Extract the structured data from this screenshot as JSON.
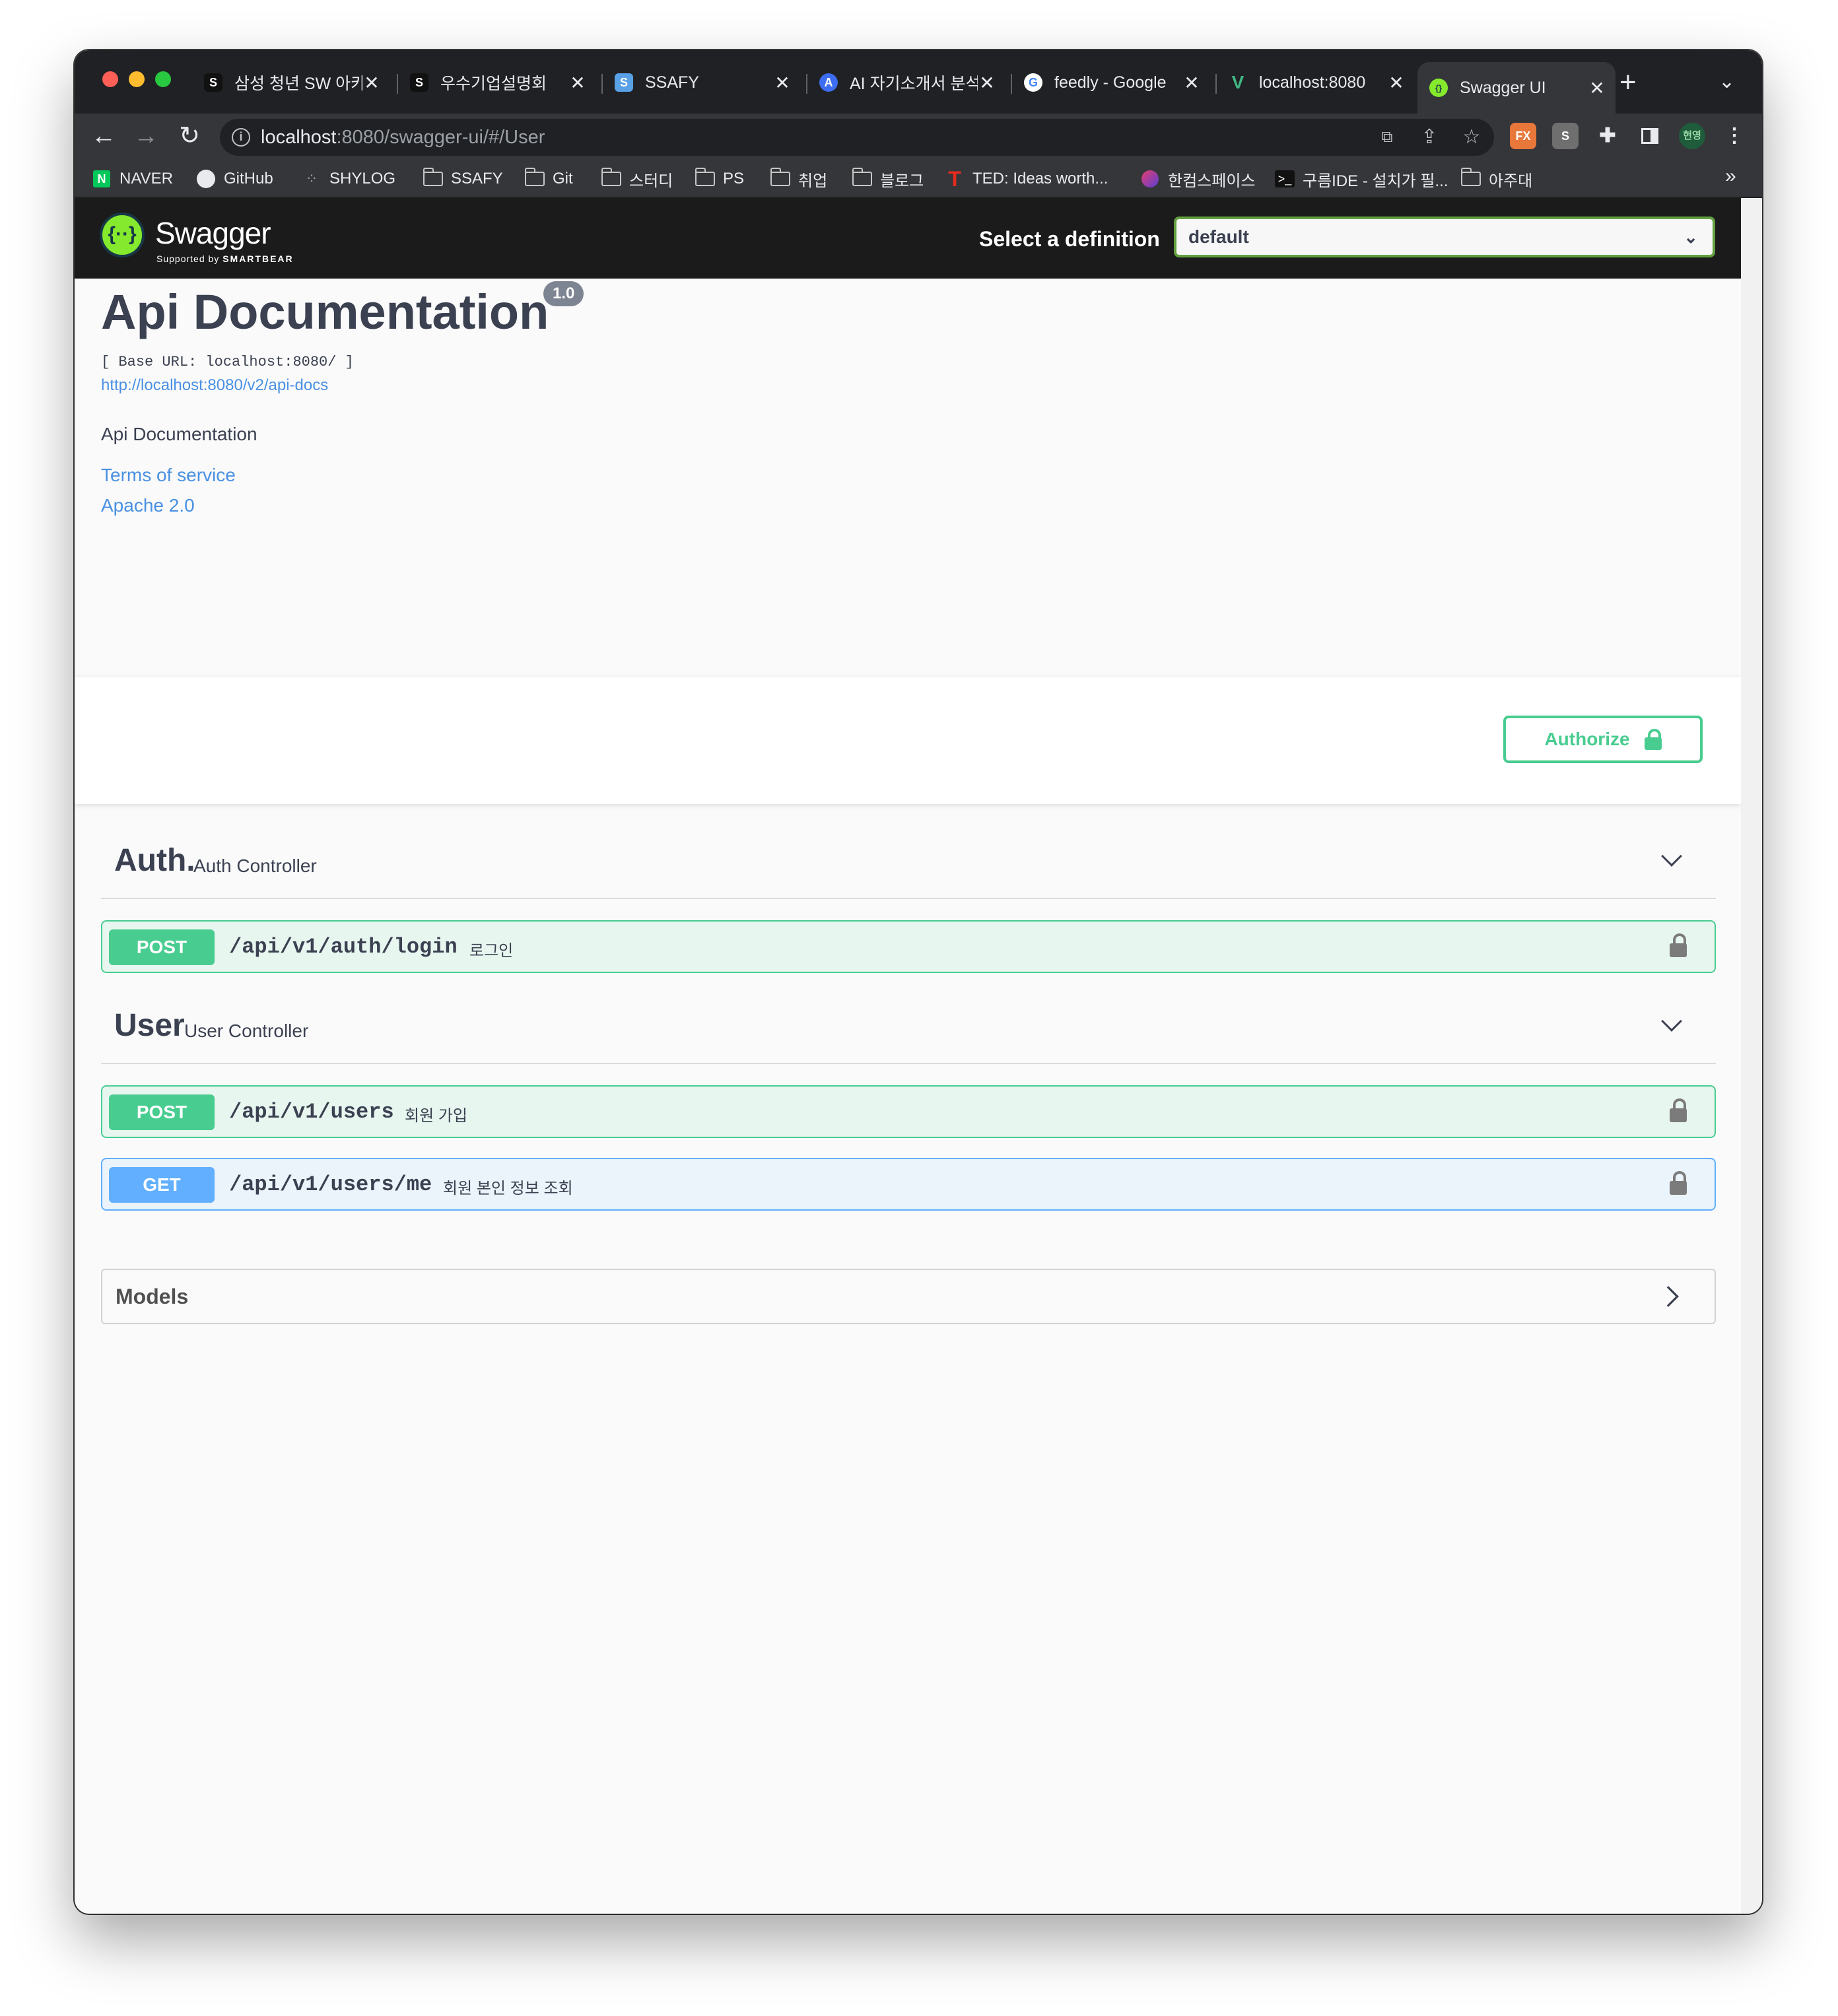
{
  "browser": {
    "tabs": [
      {
        "title": "삼성 청년 SW 아카",
        "favicon_label": "S",
        "favicon_color": "#111111"
      },
      {
        "title": "우수기업설명회",
        "favicon_label": "S",
        "favicon_color": "#111111"
      },
      {
        "title": "SSAFY",
        "favicon_label": "S",
        "favicon_color": "#5aa0e6"
      },
      {
        "title": "AI 자기소개서 분석",
        "favicon_label": "A",
        "favicon_color": "#3d6df0"
      },
      {
        "title": "feedly - Google",
        "favicon_label": "G",
        "favicon_color": "#ffffff"
      },
      {
        "title": "localhost:8080",
        "favicon_label": "V",
        "favicon_color": "#41b883"
      },
      {
        "title": "Swagger UI",
        "favicon_label": "{}",
        "favicon_color": "#85ea2d"
      }
    ],
    "tab_close_glyph": "✕",
    "new_tab_glyph": "+",
    "tab_menu_glyph": "⌄",
    "url_host": "localhost",
    "url_rest": ":8080/swagger-ui/#/User",
    "bookmarks": [
      {
        "label": "NAVER",
        "icon": "naver-icon"
      },
      {
        "label": "GitHub",
        "icon": "github-icon"
      },
      {
        "label": "SHYLOG",
        "icon": "shylog-icon"
      },
      {
        "label": "SSAFY",
        "icon": "folder-icon"
      },
      {
        "label": "Git",
        "icon": "folder-icon"
      },
      {
        "label": "스터디",
        "icon": "folder-icon"
      },
      {
        "label": "PS",
        "icon": "folder-icon"
      },
      {
        "label": "취업",
        "icon": "folder-icon"
      },
      {
        "label": "블로그",
        "icon": "folder-icon"
      },
      {
        "label": "TED: Ideas worth...",
        "icon": "ted-icon"
      },
      {
        "label": "한컴스페이스",
        "icon": "hancom-icon"
      },
      {
        "label": "구름IDE - 설치가 필...",
        "icon": "terminal-icon"
      },
      {
        "label": "아주대",
        "icon": "folder-icon"
      }
    ],
    "bookmarks_more": "»",
    "profile_label": "현영",
    "ext_fx_label": "FX",
    "ext_s_label": "S"
  },
  "swagger": {
    "logo_text": "Swagger",
    "logo_sub_prefix": "Supported by",
    "logo_sub_brand": "SMARTBEAR",
    "select_label": "Select a definition",
    "selected_definition": "default",
    "title": "Api Documentation",
    "version": "1.0",
    "base_url": "[ Base URL: localhost:8080/ ]",
    "docs_url": "http://localhost:8080/v2/api-docs",
    "description": "Api Documentation",
    "terms_label": "Terms of service",
    "license_label": "Apache 2.0",
    "authorize_label": "Authorize",
    "tags": [
      {
        "name": "Auth.",
        "description": "Auth Controller",
        "operations": [
          {
            "method": "POST",
            "path": "/api/v1/auth/login",
            "summary": "로그인"
          }
        ]
      },
      {
        "name": "User",
        "description": "User Controller",
        "operations": [
          {
            "method": "POST",
            "path": "/api/v1/users",
            "summary": "회원 가입"
          },
          {
            "method": "GET",
            "path": "/api/v1/users/me",
            "summary": "회원 본인 정보 조회"
          }
        ]
      }
    ],
    "models_label": "Models",
    "colors": {
      "post": "#49cc90",
      "get": "#61affe",
      "link": "#4990e2",
      "text": "#3b4151"
    }
  }
}
